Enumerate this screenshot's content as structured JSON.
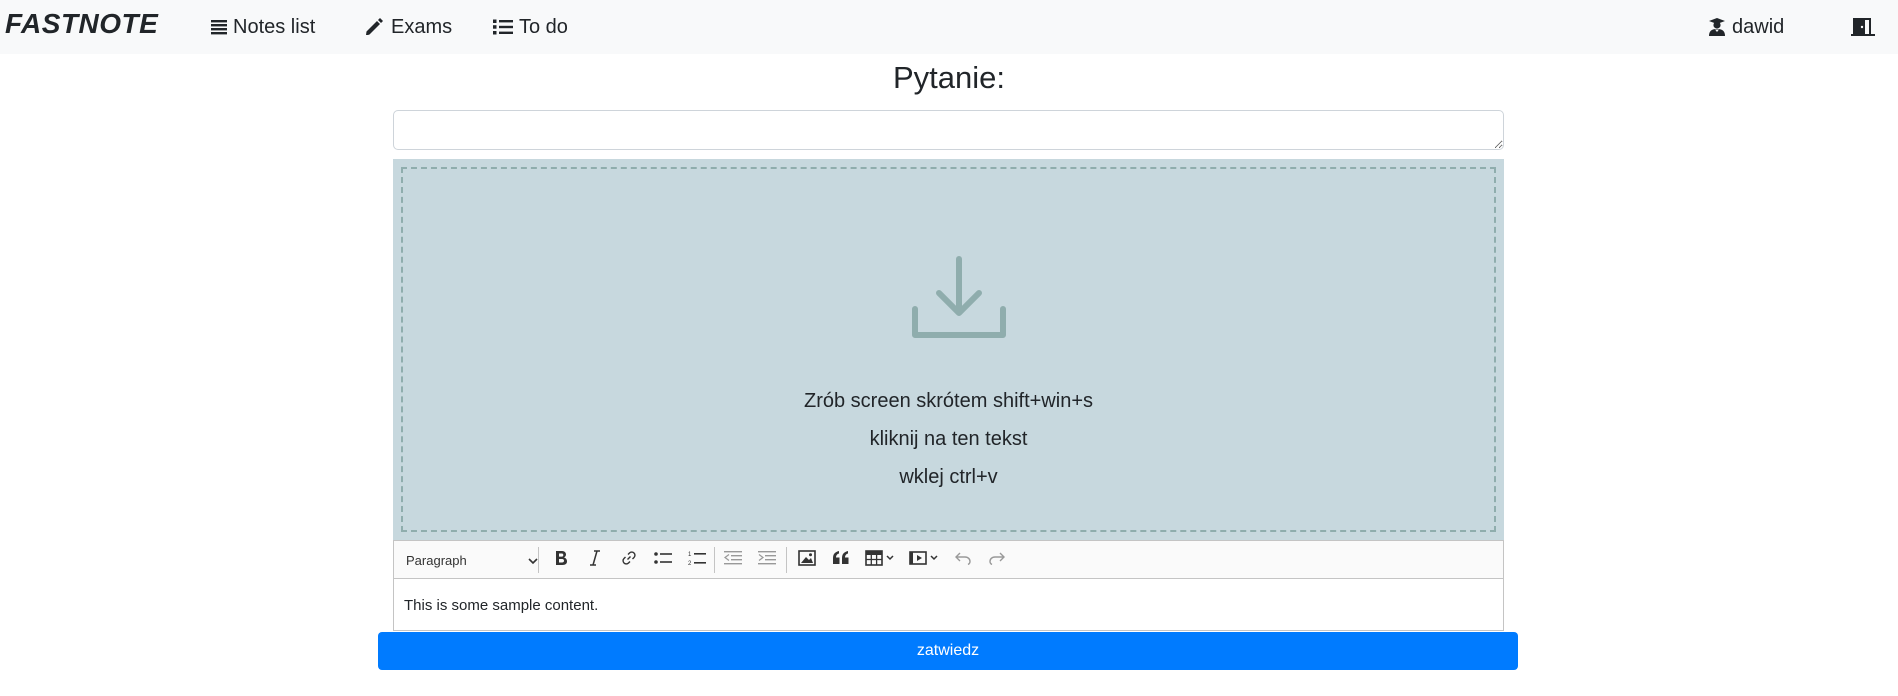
{
  "navbar": {
    "brand": "FASTNOTE",
    "links": [
      {
        "label": "Notes list",
        "icon": "list-icon"
      },
      {
        "label": "Exams",
        "icon": "pencil-icon"
      },
      {
        "label": "To do",
        "icon": "checklist-icon"
      }
    ],
    "user": {
      "label": "dawid",
      "icon": "user-graduate-icon"
    },
    "logout": {
      "icon": "door-exit-icon"
    }
  },
  "page": {
    "title": "Pytanie:"
  },
  "question_input": {
    "value": "",
    "placeholder": ""
  },
  "dropzone": {
    "icon": "download-icon",
    "lines": [
      "Zrób screen skrótem shift+win+s",
      "kliknij na ten tekst",
      "wklej ctrl+v"
    ]
  },
  "editor": {
    "heading_select": "Paragraph",
    "toolbar_icons": [
      "bold-icon",
      "italic-icon",
      "link-icon",
      "bulleted-list-icon",
      "numbered-list-icon",
      "outdent-icon",
      "indent-icon",
      "image-icon",
      "blockquote-icon",
      "table-icon",
      "media-icon",
      "undo-icon",
      "redo-icon"
    ],
    "content": "This is some sample content."
  },
  "submit": {
    "label": "zatwiedz"
  },
  "colors": {
    "navbar_bg": "#f8f9fa",
    "dropzone_bg": "#c7d8de",
    "dropzone_icon": "#8fadad",
    "primary": "#007bff"
  }
}
